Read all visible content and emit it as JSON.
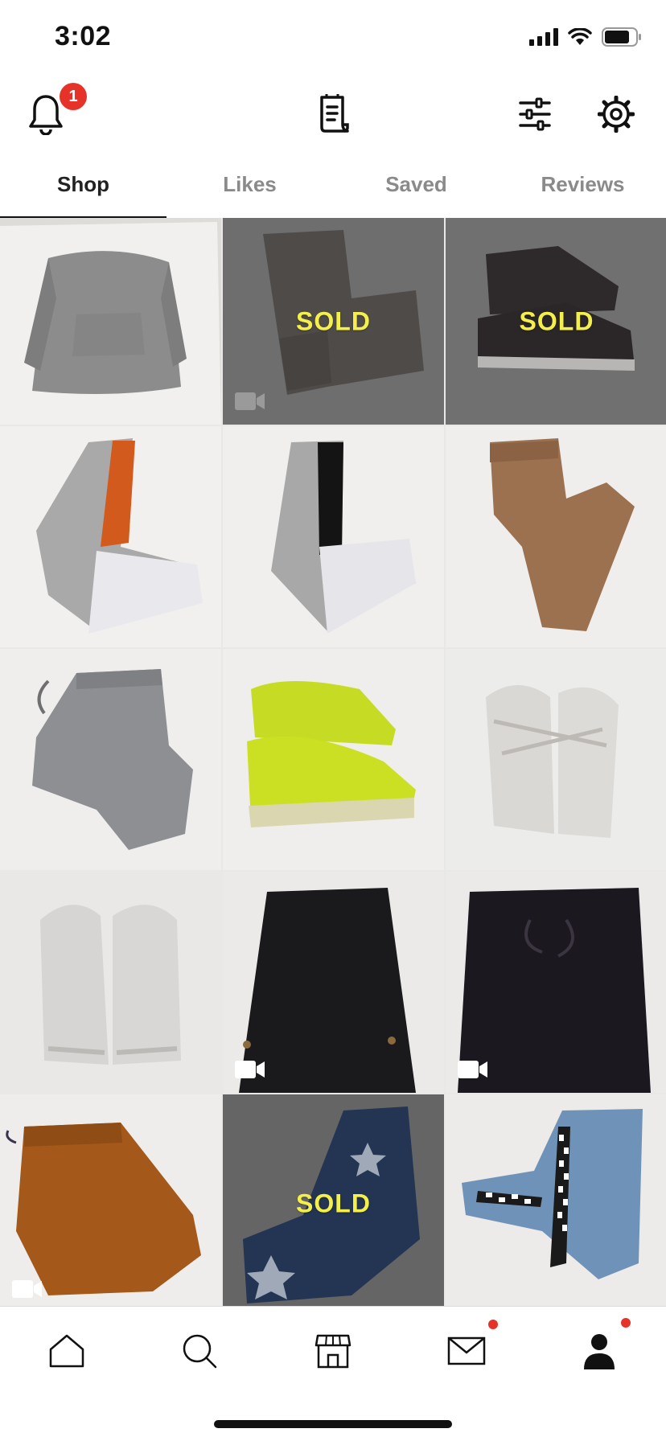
{
  "status_bar": {
    "time": "3:02"
  },
  "header": {
    "notification_count": "1"
  },
  "tabs": [
    {
      "label": "Shop",
      "active": true
    },
    {
      "label": "Likes",
      "active": false
    },
    {
      "label": "Saved",
      "active": false
    },
    {
      "label": "Reviews",
      "active": false
    }
  ],
  "grid": {
    "items": [
      {
        "name": "grey-hoodie",
        "sold": false,
        "video": false
      },
      {
        "name": "grey-distressed-shorts",
        "sold": true,
        "video": true
      },
      {
        "name": "black-converse-high-tops",
        "sold": true,
        "video": false
      },
      {
        "name": "grey-orange-colorblock-joggers",
        "sold": false,
        "video": false
      },
      {
        "name": "grey-black-colorblock-joggers",
        "sold": false,
        "video": false
      },
      {
        "name": "tan-sherpa-joggers",
        "sold": false,
        "video": false
      },
      {
        "name": "grey-sweatpants",
        "sold": false,
        "video": false
      },
      {
        "name": "neon-yellow-sneakers",
        "sold": false,
        "video": false
      },
      {
        "name": "white-air-force-sneakers",
        "sold": false,
        "video": false
      },
      {
        "name": "white-chunky-sneakers",
        "sold": false,
        "video": false
      },
      {
        "name": "black-cargo-pants",
        "sold": false,
        "video": true
      },
      {
        "name": "black-drawstring-pants",
        "sold": false,
        "video": true
      },
      {
        "name": "rust-cargo-joggers",
        "sold": false,
        "video": true
      },
      {
        "name": "star-print-jeans",
        "sold": true,
        "video": false
      },
      {
        "name": "checkered-stripe-jeans",
        "sold": false,
        "video": false
      }
    ],
    "sold_label": "SOLD"
  },
  "bottom_nav": [
    {
      "icon": "home-icon",
      "badge": false
    },
    {
      "icon": "search-icon",
      "badge": false
    },
    {
      "icon": "shop-icon",
      "badge": false
    },
    {
      "icon": "mail-icon",
      "badge": true
    },
    {
      "icon": "profile-icon",
      "badge": true
    }
  ],
  "colors": {
    "accent_red": "#e63329",
    "sold_yellow": "#f5ef4a"
  }
}
